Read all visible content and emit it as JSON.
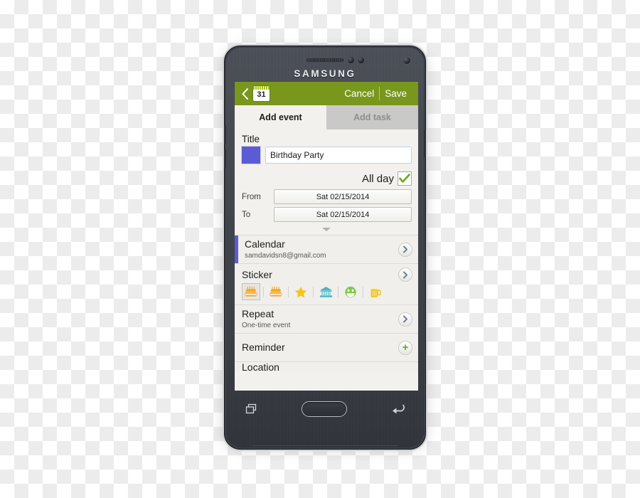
{
  "device": {
    "brand": "SAMSUNG",
    "hardware": {
      "speaker_grille": "speaker-grille",
      "proximity_sensor": "sensor-icon",
      "light_sensor": "sensor-icon",
      "front_camera": "front-camera-icon"
    },
    "nav_bar": {
      "recents": "recents-icon",
      "home": "home-button",
      "back": "back-arrow-icon"
    }
  },
  "app": {
    "action_bar": {
      "back_icon": "back-chevron-icon",
      "calendar_icon": "calendar-icon",
      "calendar_icon_day": "31",
      "cancel_label": "Cancel",
      "save_label": "Save",
      "background_color": "#79971d",
      "text_color": "#ffffff"
    },
    "tabs": [
      {
        "label": "Add event",
        "active": true
      },
      {
        "label": "Add task",
        "active": false
      }
    ],
    "form": {
      "title_label": "Title",
      "title_value": "Birthday Party",
      "title_placeholder": "Title",
      "color_swatch": "#5b5bd6",
      "allday_label": "All day",
      "allday_checked": true,
      "allday_check_color": "#6aa81c",
      "from_label": "From",
      "from_value": "Sat 02/15/2014",
      "to_label": "To",
      "to_value": "Sat 02/15/2014",
      "expand_icon": "chevron-down-icon"
    },
    "rows": {
      "calendar": {
        "title": "Calendar",
        "subtitle": "samdavidsn8@gmail.com",
        "accent_color": "#5b5bd6",
        "chevron_icon": "chevron-right-icon"
      },
      "sticker": {
        "title": "Sticker",
        "chevron_icon": "chevron-right-icon",
        "items": [
          {
            "name": "birthday-cake-icon",
            "color": "#f5a623",
            "selected": true
          },
          {
            "name": "birthday-cake-icon",
            "color": "#f5a623",
            "selected": false
          },
          {
            "name": "star-icon",
            "color": "#f5c518",
            "selected": false
          },
          {
            "name": "bank-building-icon",
            "color": "#4fb3c6",
            "selected": false
          },
          {
            "name": "smiley-face-icon",
            "color": "#7ac943",
            "selected": false
          },
          {
            "name": "beer-mug-icon",
            "color": "#f0c419",
            "selected": false
          }
        ]
      },
      "repeat": {
        "title": "Repeat",
        "subtitle": "One-time event",
        "chevron_icon": "chevron-right-icon"
      },
      "reminder": {
        "title": "Reminder",
        "add_icon": "plus-icon",
        "add_label": "+"
      },
      "location": {
        "title": "Location"
      }
    }
  }
}
